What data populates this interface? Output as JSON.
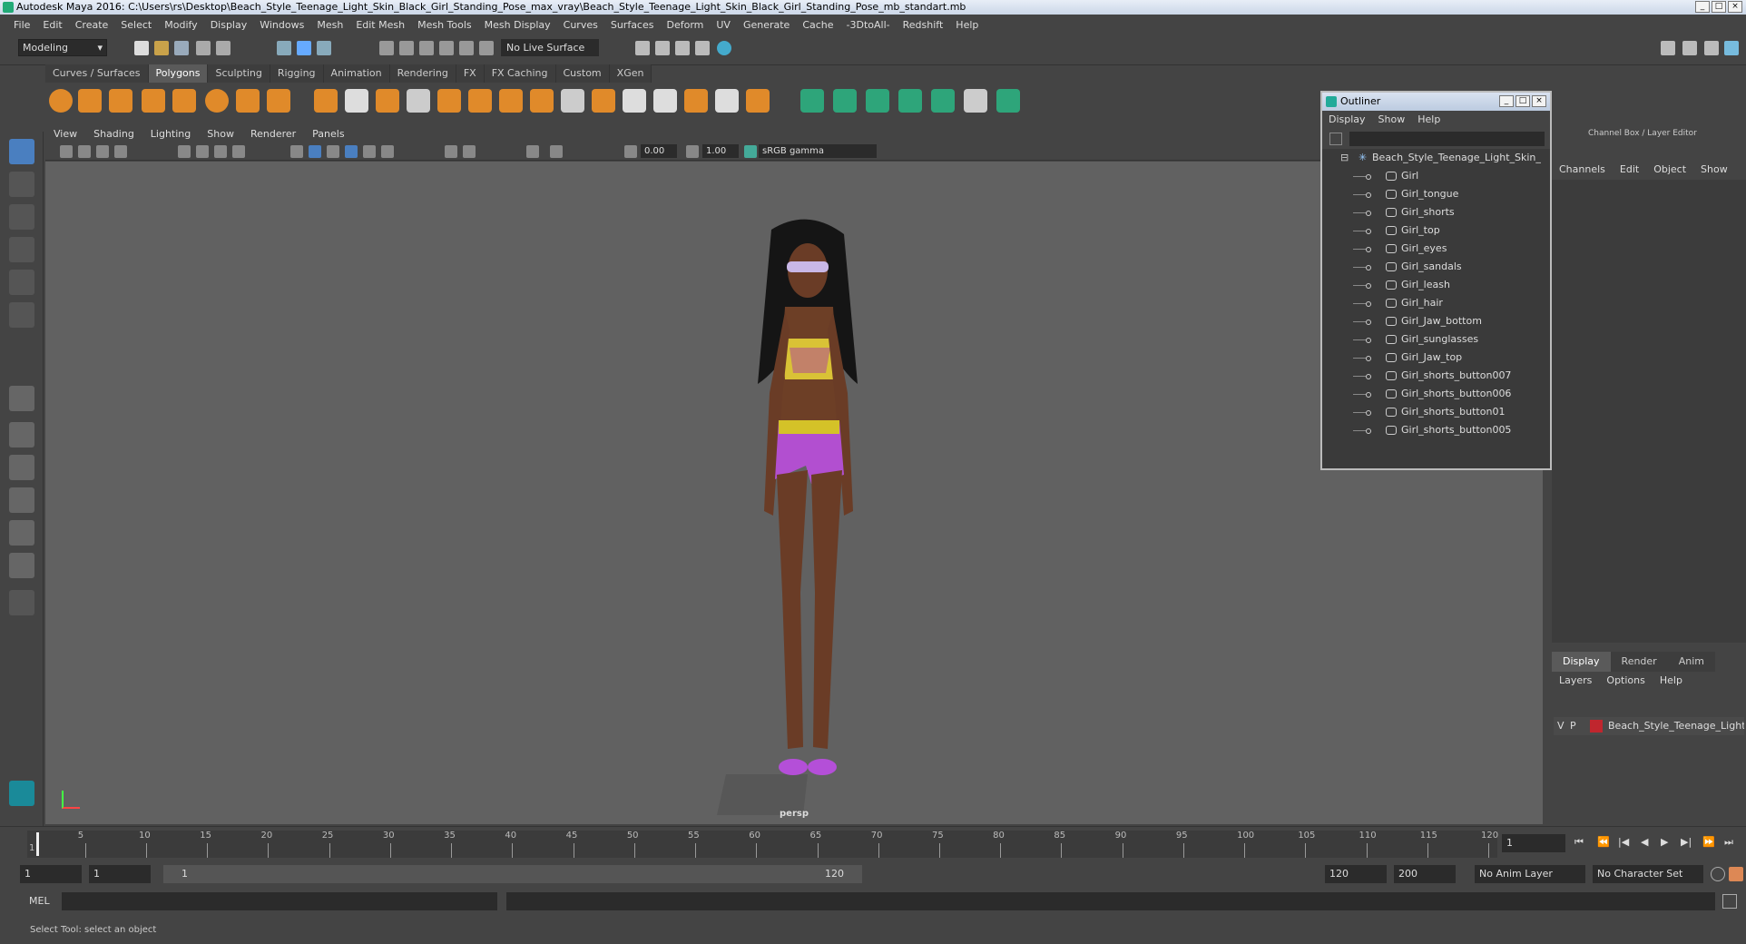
{
  "window": {
    "title": "Autodesk Maya 2016: C:\\Users\\rs\\Desktop\\Beach_Style_Teenage_Light_Skin_Black_Girl_Standing_Pose_max_vray\\Beach_Style_Teenage_Light_Skin_Black_Girl_Standing_Pose_mb_standart.mb"
  },
  "menubar": [
    "File",
    "Edit",
    "Create",
    "Select",
    "Modify",
    "Display",
    "Windows",
    "Mesh",
    "Edit Mesh",
    "Mesh Tools",
    "Mesh Display",
    "Curves",
    "Surfaces",
    "Deform",
    "UV",
    "Generate",
    "Cache",
    "-3DtoAll-",
    "Redshift",
    "Help"
  ],
  "status": {
    "mode": "Modeling",
    "live_surface": "No Live Surface"
  },
  "shelf_tabs": [
    "Curves / Surfaces",
    "Polygons",
    "Sculpting",
    "Rigging",
    "Animation",
    "Rendering",
    "FX",
    "FX Caching",
    "Custom",
    "XGen"
  ],
  "active_shelf": "Polygons",
  "panel_menu": [
    "View",
    "Shading",
    "Lighting",
    "Show",
    "Renderer",
    "Panels"
  ],
  "panel_toolbar": {
    "exposure": "0.00",
    "gamma": "1.00",
    "color_space": "sRGB gamma"
  },
  "viewport": {
    "camera": "persp"
  },
  "outliner": {
    "title": "Outliner",
    "menu": [
      "Display",
      "Show",
      "Help"
    ],
    "root": "Beach_Style_Teenage_Light_Skin_",
    "items": [
      "Girl",
      "Girl_tongue",
      "Girl_shorts",
      "Girl_top",
      "Girl_eyes",
      "Girl_sandals",
      "Girl_leash",
      "Girl_hair",
      "Girl_Jaw_bottom",
      "Girl_sunglasses",
      "Girl_Jaw_top",
      "Girl_shorts_button007",
      "Girl_shorts_button006",
      "Girl_shorts_button01",
      "Girl_shorts_button005"
    ]
  },
  "channel_box": {
    "title": "Channel Box / Layer Editor",
    "menu": [
      "Channels",
      "Edit",
      "Object",
      "Show"
    ],
    "layer_tabs": [
      "Display",
      "Render",
      "Anim"
    ],
    "active_tab": "Display",
    "layer_menu": [
      "Layers",
      "Options",
      "Help"
    ],
    "layer": {
      "v": "V",
      "p": "P",
      "name": "Beach_Style_Teenage_Light_S",
      "color": "#c0262e"
    }
  },
  "timeline": {
    "ticks": [
      "5",
      "10",
      "15",
      "20",
      "25",
      "30",
      "35",
      "40",
      "45",
      "50",
      "55",
      "60",
      "65",
      "70",
      "75",
      "80",
      "85",
      "90",
      "95",
      "100",
      "105",
      "110",
      "115",
      "120"
    ],
    "start_label": "1",
    "current_frame": "1"
  },
  "range": {
    "start": "1",
    "playback_start": "1",
    "slider_start": "1",
    "slider_end": "120",
    "playback_end": "120",
    "end": "200",
    "anim_layer": "No Anim Layer",
    "character_set": "No Character Set"
  },
  "command": {
    "label": "MEL"
  },
  "help": {
    "text": "Select Tool: select an object"
  }
}
